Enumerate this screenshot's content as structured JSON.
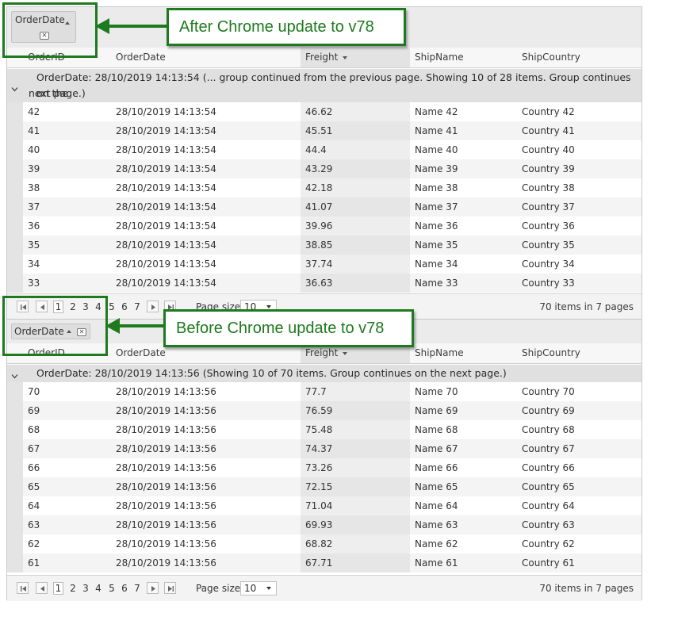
{
  "columns": [
    "OrderID",
    "OrderDate",
    "Freight",
    "ShipName",
    "ShipCountry"
  ],
  "colors": {
    "annotation_green": "#1e7a1e",
    "group_row": "#e0e0e0",
    "header": "#f7f7f7"
  },
  "grid_top": {
    "group_chip": {
      "label": "OrderDate",
      "sort": "ascending",
      "remove_icon": "close-icon"
    },
    "sorted_column": "Freight",
    "group_header": "OrderDate: 28/10/2019 14:13:54 (... group continued from the previous page. Showing 10 of 28 items. Group continues on the next page.)",
    "group_header_line1": "OrderDate: 28/10/2019 14:13:54 (... group continued from the previous page. Showing 10 of 28 items. Group continues on the",
    "group_header_line2": "next page.)",
    "rows": [
      [
        "42",
        "28/10/2019 14:13:54",
        "46.62",
        "Name 42",
        "Country 42"
      ],
      [
        "41",
        "28/10/2019 14:13:54",
        "45.51",
        "Name 41",
        "Country 41"
      ],
      [
        "40",
        "28/10/2019 14:13:54",
        "44.4",
        "Name 40",
        "Country 40"
      ],
      [
        "39",
        "28/10/2019 14:13:54",
        "43.29",
        "Name 39",
        "Country 39"
      ],
      [
        "38",
        "28/10/2019 14:13:54",
        "42.18",
        "Name 38",
        "Country 38"
      ],
      [
        "37",
        "28/10/2019 14:13:54",
        "41.07",
        "Name 37",
        "Country 37"
      ],
      [
        "36",
        "28/10/2019 14:13:54",
        "39.96",
        "Name 36",
        "Country 36"
      ],
      [
        "35",
        "28/10/2019 14:13:54",
        "38.85",
        "Name 35",
        "Country 35"
      ],
      [
        "34",
        "28/10/2019 14:13:54",
        "37.74",
        "Name 34",
        "Country 34"
      ],
      [
        "33",
        "28/10/2019 14:13:54",
        "36.63",
        "Name 33",
        "Country 33"
      ]
    ],
    "pager": {
      "pages": [
        "1",
        "2",
        "3",
        "4",
        "5",
        "6",
        "7"
      ],
      "current_page": "1",
      "page_size_label": "Page size:",
      "page_size": "10",
      "info": "70 items in 7 pages"
    }
  },
  "grid_bottom": {
    "group_chip": {
      "label": "OrderDate",
      "sort": "ascending",
      "remove_icon": "close-icon"
    },
    "sorted_column": "Freight",
    "group_header": "OrderDate: 28/10/2019 14:13:56 (Showing 10 of 70 items. Group continues on the next page.)",
    "rows": [
      [
        "70",
        "28/10/2019 14:13:56",
        "77.7",
        "Name 70",
        "Country 70"
      ],
      [
        "69",
        "28/10/2019 14:13:56",
        "76.59",
        "Name 69",
        "Country 69"
      ],
      [
        "68",
        "28/10/2019 14:13:56",
        "75.48",
        "Name 68",
        "Country 68"
      ],
      [
        "67",
        "28/10/2019 14:13:56",
        "74.37",
        "Name 67",
        "Country 67"
      ],
      [
        "66",
        "28/10/2019 14:13:56",
        "73.26",
        "Name 66",
        "Country 66"
      ],
      [
        "65",
        "28/10/2019 14:13:56",
        "72.15",
        "Name 65",
        "Country 65"
      ],
      [
        "64",
        "28/10/2019 14:13:56",
        "71.04",
        "Name 64",
        "Country 64"
      ],
      [
        "63",
        "28/10/2019 14:13:56",
        "69.93",
        "Name 63",
        "Country 63"
      ],
      [
        "62",
        "28/10/2019 14:13:56",
        "68.82",
        "Name 62",
        "Country 62"
      ],
      [
        "61",
        "28/10/2019 14:13:56",
        "67.71",
        "Name 61",
        "Country 61"
      ]
    ],
    "pager": {
      "pages": [
        "1",
        "2",
        "3",
        "4",
        "5",
        "6",
        "7"
      ],
      "current_page": "1",
      "page_size_label": "Page size:",
      "page_size": "10",
      "info": "70 items in 7 pages"
    }
  },
  "annotations": {
    "top_callout": "After Chrome update to v78",
    "bottom_callout": "Before Chrome update to v78"
  }
}
